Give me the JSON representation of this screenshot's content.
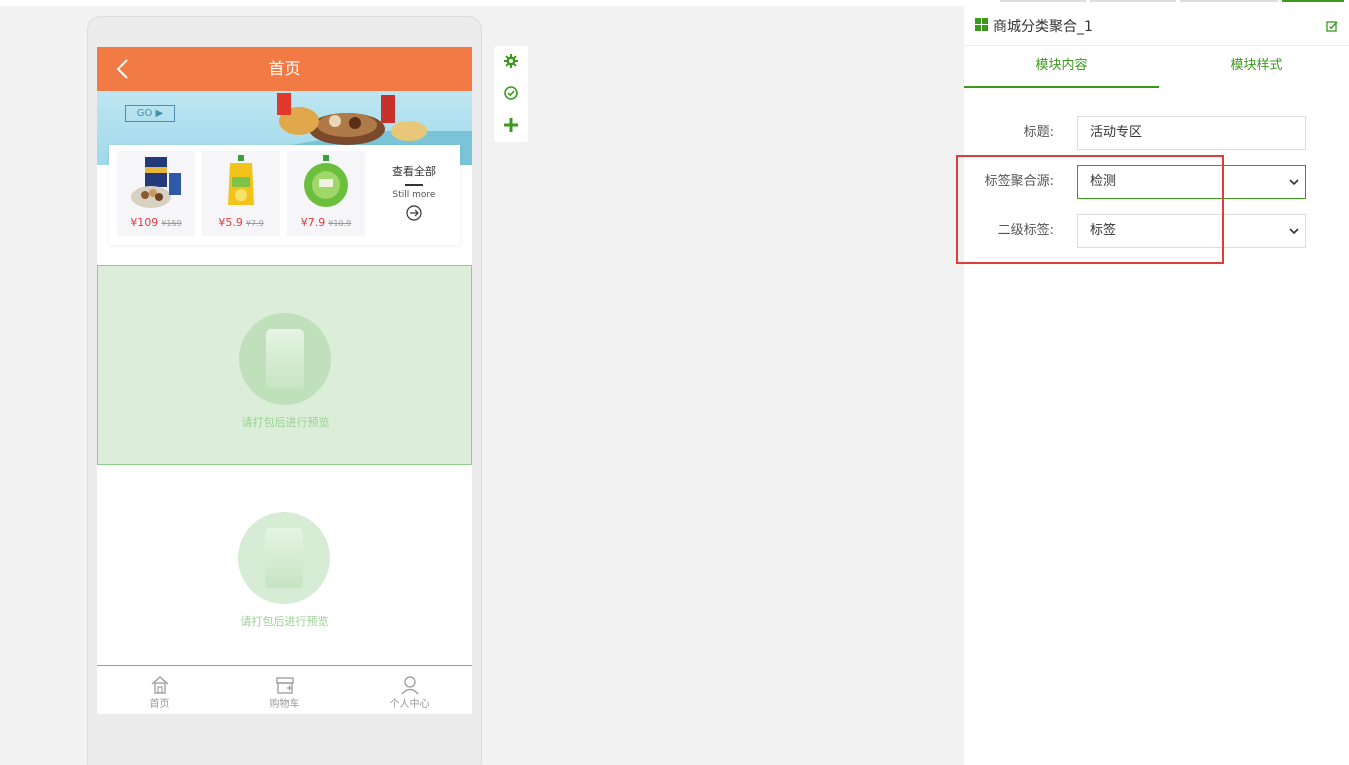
{
  "phone": {
    "nav_title": "首页",
    "banner_button": "GO ▶",
    "goods": [
      {
        "price": "¥109",
        "old_price": "¥159"
      },
      {
        "price": "¥5.9",
        "old_price": "¥7.9"
      },
      {
        "price": "¥7.9",
        "old_price": "¥10.9"
      }
    ],
    "see_all": {
      "title": "查看全部",
      "subtitle": "Still more"
    },
    "placeholder_text_1": "请打包后进行预览",
    "placeholder_text_2": "请打包后进行预览",
    "tabbar": [
      {
        "label": "首页",
        "icon": "home-icon"
      },
      {
        "label": "购物车",
        "icon": "cart-icon"
      },
      {
        "label": "个人中心",
        "icon": "user-icon"
      }
    ]
  },
  "tools": [
    "gear-icon",
    "check-circle-icon",
    "plus-icon"
  ],
  "panel": {
    "title": "商城分类聚合_1",
    "tabs": [
      {
        "label": "模块内容",
        "active": true
      },
      {
        "label": "模块样式",
        "active": false
      }
    ],
    "fields": {
      "title_label": "标题:",
      "title_value": "活动专区",
      "source_label": "标签聚合源:",
      "source_value": "检测",
      "secondary_label": "二级标签:",
      "secondary_value": "标签"
    }
  },
  "colors": {
    "nav": "#f27a45",
    "accent_green": "#3b9a1e",
    "price_red": "#e8383d",
    "highlight": "#e33a3a"
  }
}
